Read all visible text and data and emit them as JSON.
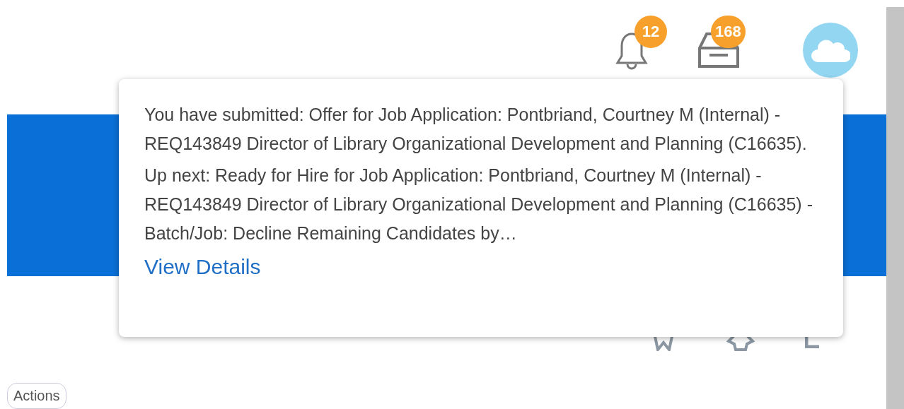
{
  "header": {
    "notifications": {
      "badge": "12"
    },
    "inbox": {
      "badge": "168"
    }
  },
  "popup": {
    "messages": [
      "You have submitted: Offer for Job Application: Pontbriand, Courtney M (Internal) - REQ143849 Director of Library Organizational Development and Planning (C16635).",
      "Up next: Ready for Hire for Job Application: Pontbriand, Courtney M (Internal) - REQ143849 Director of Library Organizational Development and Planning (C16635) - Batch/Job: Decline Remaining Candidates by…"
    ],
    "link": "View Details"
  },
  "actions_button": "Actions"
}
